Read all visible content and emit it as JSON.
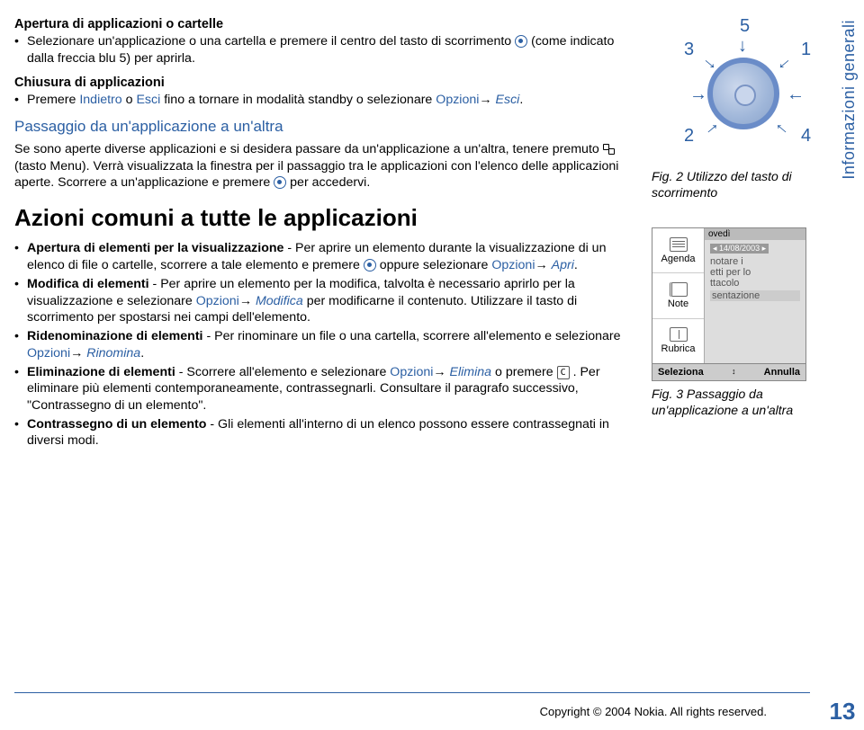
{
  "sidetab": "Informazioni generali",
  "section1": {
    "title": "Apertura di applicazioni o cartelle",
    "bullet": "Selezionare un'applicazione o una cartella e premere il centro del tasto di scorrimento",
    "bullet_tail": "(come indicato dalla freccia blu 5) per aprirla."
  },
  "section2": {
    "title": "Chiusura di applicazioni",
    "bullet_pre": "Premere ",
    "link1": "Indietro",
    "mid1": " o ",
    "link2": "Esci",
    "mid2": " fino a tornare in modalità standby o selezionare ",
    "link3": "Opzioni",
    "arrow": "→ ",
    "ital": "Esci",
    "end": "."
  },
  "section3": {
    "title": "Passaggio da un'applicazione a un'altra",
    "p1a": "Se sono aperte diverse applicazioni e si desidera passare da un'applicazione a un'altra, tenere premuto ",
    "p1b": " (tasto Menu). Verrà visualizzata la finestra per il passaggio tra le applicazioni con l'elenco delle applicazioni aperte. Scorrere a un'applicazione e premere",
    "p1c": " per accedervi."
  },
  "big_heading": "Azioni comuni a tutte le applicazioni",
  "common": {
    "b1_bold": "Apertura di elementi per la visualizzazione",
    "b1_dash": " - Per aprire un elemento durante la visualizzazione di un elenco di file o cartelle, scorrere a tale elemento e premere ",
    "b1_or": "oppure selezionare ",
    "b1_link": "Opzioni",
    "b1_arrow": "→ ",
    "b1_ital": "Apri",
    "b1_end": ".",
    "b2_bold": "Modifica di elementi",
    "b2_a": " - Per aprire un elemento per la modifica, talvolta è necessario aprirlo per la visualizzazione e selezionare ",
    "b2_link": "Opzioni",
    "b2_arrow": "→ ",
    "b2_ital": "Modifica",
    "b2_b": " per modificarne il contenuto. Utilizzare il tasto di scorrimento per spostarsi nei campi dell'elemento.",
    "b3_bold": "Ridenominazione di elementi",
    "b3_a": " - Per rinominare un file o una cartella, scorrere all'elemento e selezionare ",
    "b3_link": "Opzioni",
    "b3_arrow": "→ ",
    "b3_ital": "Rinomina",
    "b3_end": ".",
    "b4_bold": "Eliminazione di elementi",
    "b4_a": " - Scorrere all'elemento e selezionare ",
    "b4_link": "Opzioni",
    "b4_arrow": "→ ",
    "b4_ital": "Elimina",
    "b4_b": " o premere ",
    "b4_c": "C",
    "b4_d": " . Per eliminare più elementi contemporaneamente, contrassegnarli. Consultare il paragrafo successivo, \"Contrassegno di un elemento\".",
    "b5_bold": "Contrassegno di un elemento",
    "b5_a": " - Gli elementi all'interno di un elenco possono essere contrassegnati in diversi modi."
  },
  "fig2": {
    "n1": "1",
    "n2": "2",
    "n3": "3",
    "n4": "4",
    "n5": "5",
    "caption": "Fig. 2 Utilizzo del tasto di scorrimento"
  },
  "phone": {
    "m1": "Agenda",
    "m2": "Note",
    "m3": "Rubrica",
    "head": "ovedì",
    "date": "14/08/2003",
    "l1": "notare i",
    "l2": "etti per lo",
    "l3": "ttacolo",
    "l4": "sentazione",
    "soft_l": "Seleziona",
    "soft_m": "↕",
    "soft_r": "Annulla"
  },
  "fig3": {
    "caption": "Fig. 3 Passaggio da un'applicazione a un'altra"
  },
  "footer": {
    "copy": "Copyright © 2004 Nokia. All rights reserved.",
    "page": "13"
  }
}
